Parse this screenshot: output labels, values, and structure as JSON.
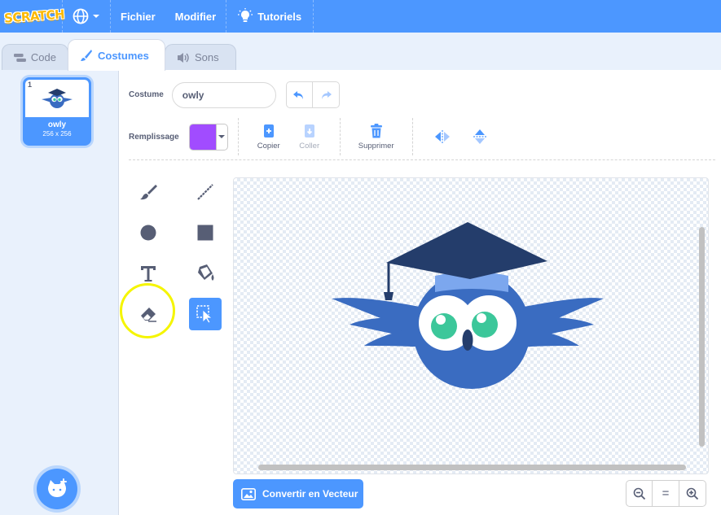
{
  "menubar": {
    "logo": "SCRATCH",
    "file": "Fichier",
    "edit": "Modifier",
    "tutorials": "Tutoriels",
    "icons": [
      "globe-icon",
      "chevron-down-icon",
      "lightbulb-icon"
    ]
  },
  "tabs": [
    {
      "label": "Code",
      "icon": "code-icon",
      "active": false
    },
    {
      "label": "Costumes",
      "icon": "brush-icon",
      "active": true
    },
    {
      "label": "Sons",
      "icon": "speaker-icon",
      "active": false
    }
  ],
  "costumes": [
    {
      "number": "1",
      "name": "owly",
      "size": "256 x 256",
      "selected": true
    }
  ],
  "editor": {
    "costume_label": "Costume",
    "costume_name": "owly",
    "fill_label": "Remplissage",
    "fill_color": "#a14cff",
    "copy": "Copier",
    "paste": "Coller",
    "delete": "Supprimer",
    "convert": "Convertir en Vecteur",
    "zoom_reset": "="
  },
  "tools": [
    "brush",
    "line",
    "circle",
    "rectangle",
    "text",
    "fill",
    "eraser",
    "select"
  ],
  "selected_tool": "select",
  "highlighted_tool": "eraser",
  "colors": {
    "accent": "#4c97ff",
    "highlight": "#f5f500",
    "owl_body": "#3a6cc1",
    "owl_cap": "#243d6b"
  }
}
